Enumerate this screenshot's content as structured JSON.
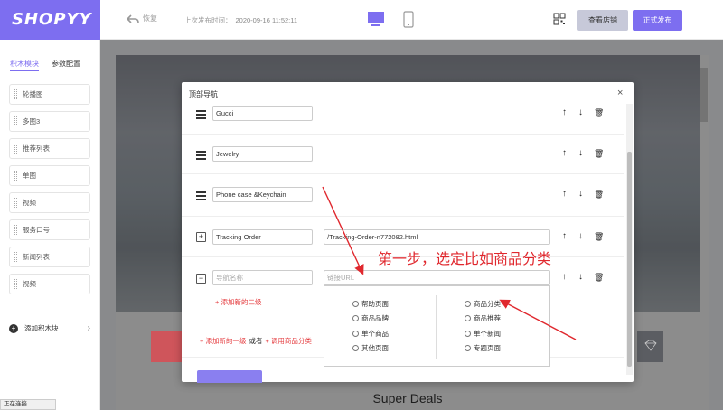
{
  "app": {
    "logo": "SHOPYY",
    "undo_label": "恢复",
    "publish_time_label": "上次发布时间：",
    "publish_time_value": "2020-09-16 11:52:11",
    "view_store_label": "查看店铺",
    "publish_label": "正式发布",
    "devices": [
      "desktop-icon",
      "mobile-icon"
    ],
    "accent": "#7d6ef0"
  },
  "sidebar": {
    "tabs": [
      {
        "label": "积木模块",
        "active": true
      },
      {
        "label": "参数配置",
        "active": false
      }
    ],
    "items": [
      {
        "label": "轮播图"
      },
      {
        "label": "多图3"
      },
      {
        "label": "推荐列表"
      },
      {
        "label": "单图"
      },
      {
        "label": "视频"
      },
      {
        "label": "服务口号"
      },
      {
        "label": "新闻列表"
      },
      {
        "label": "视频"
      }
    ],
    "add_block_label": "添加积木块"
  },
  "status_bar": "正在连接...",
  "canvas": {
    "heading": "Super Deals"
  },
  "modal": {
    "title": "顶部导航",
    "close": "×",
    "rows": [
      {
        "name": "Gucci",
        "url": ""
      },
      {
        "name": "Jewelry",
        "url": ""
      },
      {
        "name": "Phone case &Keychain",
        "url": ""
      },
      {
        "name": "Tracking Order",
        "url": "/Tracking-Order-n772082.html"
      },
      {
        "name": "",
        "url": "",
        "name_placeholder": "导航名称",
        "url_placeholder": "链接URL"
      }
    ],
    "add_sub_label": "+ 添加新的二级",
    "add_first_label": "+ 添加新的一级",
    "or_label": "或者",
    "call_category_label": "+ 调用商品分类",
    "link_options_left": [
      "帮助页面",
      "商品品牌",
      "单个商品",
      "其他页面"
    ],
    "link_options_right": [
      "商品分类",
      "商品推荐",
      "单个新闻",
      "专题页面"
    ]
  },
  "annotation": {
    "text": "第一步，选定比如商品分类",
    "color": "#e0282e"
  }
}
